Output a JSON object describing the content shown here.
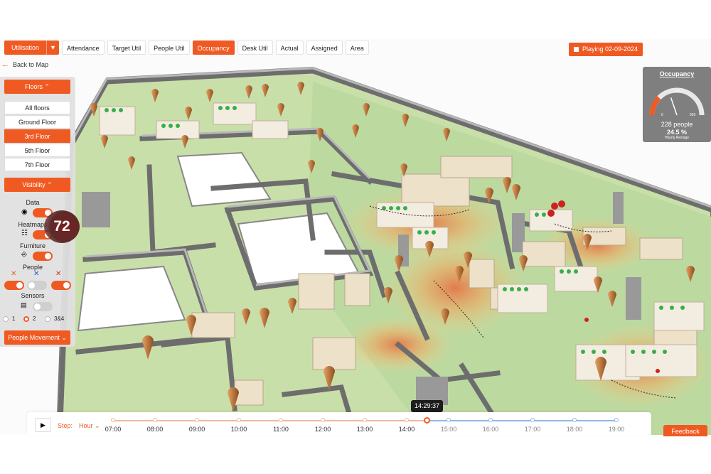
{
  "toolbar": {
    "mode_label": "Utilisation",
    "tabs": [
      "Attendance",
      "Target Util",
      "People Util",
      "Occupancy",
      "Desk Util",
      "Actual",
      "Assigned",
      "Area"
    ],
    "active_tab": "Occupancy",
    "playing_label": "Playing 02-09-2024"
  },
  "nav": {
    "back_label": "Back to Map"
  },
  "panel": {
    "floors_label": "Floors",
    "floors": [
      "All floors",
      "Ground Floor",
      "3rd Floor",
      "5th Floor",
      "7th Floor"
    ],
    "active_floor": "3rd Floor",
    "visibility_label": "Visibility",
    "toggles": {
      "data": {
        "label": "Data",
        "on": true
      },
      "heatmaps": {
        "label": "Heatmaps",
        "on": true
      },
      "furniture": {
        "label": "Furniture",
        "on": true
      },
      "people": {
        "label": "People"
      },
      "sensors": {
        "label": "Sensors",
        "on": false
      }
    },
    "sensor_options": [
      "1",
      "2",
      "3&4"
    ],
    "selected_sensor_option": "2",
    "movement_label": "People Movement",
    "badge_value": "72"
  },
  "gauge": {
    "title": "Occupancy",
    "min": "0",
    "mid": "465",
    "max": "929",
    "people": "228 people",
    "percent": "24.5 %",
    "avg_label": "Hourly Average",
    "fraction": 0.245
  },
  "timeline": {
    "step_label": "Step:",
    "hour_label": "Hour",
    "hours": [
      "07:00",
      "08:00",
      "09:00",
      "10:00",
      "11:00",
      "12:00",
      "13:00",
      "14:00",
      "15:00",
      "16:00",
      "17:00",
      "18:00",
      "19:00"
    ],
    "current_time": "14:29:37",
    "feedback_label": "Feedback"
  },
  "colors": {
    "accent": "#ef5a23",
    "floor_green": "#c8dfa8",
    "wall_gray": "#8a8a8a",
    "timeline_future": "#8fb8ea"
  },
  "icons": {
    "play": "play-icon",
    "back": "arrow-left-icon",
    "chevron": "chevron-down-icon"
  }
}
